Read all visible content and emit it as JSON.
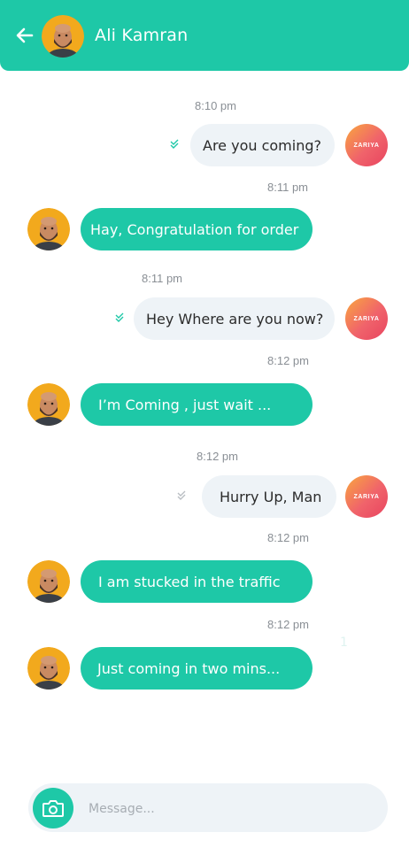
{
  "header": {
    "title": "Ali Kamran",
    "back_icon": "arrow-left-icon",
    "background": "#1ec8a7"
  },
  "brand": {
    "logo_text": "ZARIYA"
  },
  "messages": [
    {
      "direction": "outgoing",
      "text": "Are you coming?",
      "time": "8:10 pm",
      "status": "read"
    },
    {
      "direction": "incoming",
      "text": "Hay, Congratulation for order",
      "time": "8:11 pm"
    },
    {
      "direction": "outgoing",
      "text": "Hey Where are you now?",
      "time": "8:11 pm",
      "status": "read"
    },
    {
      "direction": "incoming",
      "text": "I’m Coming , just wait ...",
      "time": "8:12 pm"
    },
    {
      "direction": "outgoing",
      "text": "Hurry Up, Man",
      "time": "8:12 pm",
      "status": "sent"
    },
    {
      "direction": "incoming",
      "text": "I am stucked in the traffic",
      "time": "8:12 pm"
    },
    {
      "direction": "incoming",
      "text": "Just coming in two mins...",
      "time": "8:12 pm"
    }
  ],
  "stray_mark": "1",
  "composer": {
    "placeholder": "Message...",
    "value": "",
    "camera_icon": "camera-icon"
  },
  "colors": {
    "accent": "#1ec8a7",
    "outgoing_bubble": "#eef3f7",
    "read_check": "#1ec8a7",
    "sent_check": "#b9bec3"
  }
}
